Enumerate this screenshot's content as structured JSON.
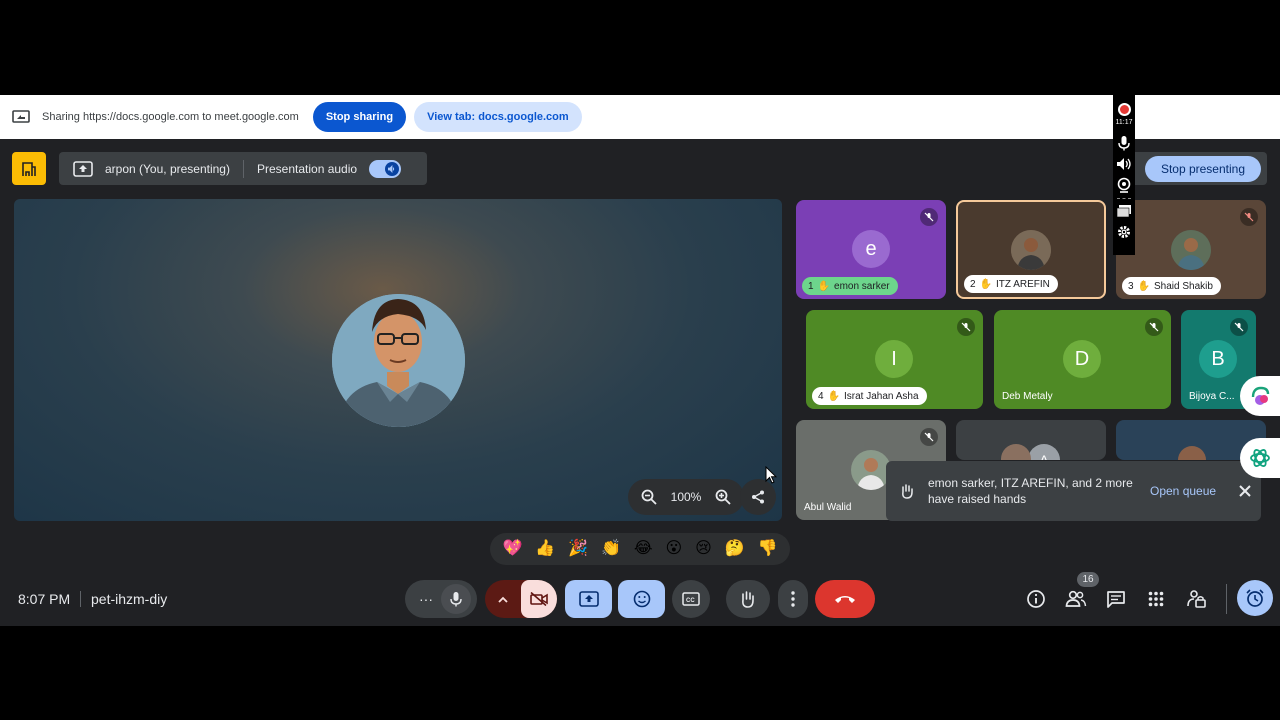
{
  "share_bar": {
    "text": "Sharing https://docs.google.com to meet.google.com",
    "stop_label": "Stop sharing",
    "view_tab_label": "View tab: docs.google.com"
  },
  "recorder": {
    "time": "11:17"
  },
  "present_bar": {
    "presenter": "arpon (You, presenting)",
    "audio_label": "Presentation audio",
    "audio_on": true
  },
  "stop_presenting_label": "Stop presenting",
  "stage": {
    "zoom": "100%"
  },
  "tiles": [
    {
      "num": "1",
      "name": "emon sarker",
      "initial": "e",
      "color": "#7b3fb5"
    },
    {
      "num": "2",
      "name": "ITZ AREFIN"
    },
    {
      "num": "3",
      "name": "Shaid Shakib"
    },
    {
      "num": "4",
      "name": "Israt Jahan Asha",
      "initial": "I",
      "color": "#5e9c2f"
    },
    {
      "name": "Deb Metaly",
      "initial": "D",
      "color": "#5e9c2f"
    },
    {
      "name": "Bijoya C...",
      "initial": "B",
      "color": "#1e8e7e"
    },
    {
      "name": "Abul Walid"
    },
    {
      "initial": "A"
    }
  ],
  "toast": {
    "text": "emon sarker, ITZ AREFIN, and 2 more have raised hands",
    "link": "Open queue"
  },
  "reactions": [
    "💖",
    "👍",
    "🎉",
    "👏",
    "😂",
    "😮",
    "😢",
    "🤔",
    "👎"
  ],
  "bottom": {
    "time": "8:07 PM",
    "meeting_code": "pet-ihzm-diy",
    "participants_count": "16"
  }
}
